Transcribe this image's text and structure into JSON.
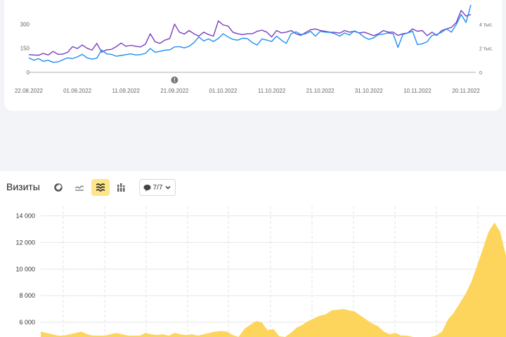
{
  "top_chart": {
    "type": "line",
    "x": [
      "22.08.2022",
      "23.08.2022",
      "24.08.2022",
      "25.08.2022",
      "26.08.2022",
      "27.08.2022",
      "28.08.2022",
      "29.08.2022",
      "30.08.2022",
      "31.08.2022",
      "01.09.2022",
      "02.09.2022",
      "03.09.2022",
      "04.09.2022",
      "05.09.2022",
      "06.09.2022",
      "07.09.2022",
      "08.09.2022",
      "09.09.2022",
      "10.09.2022",
      "11.09.2022",
      "12.09.2022",
      "13.09.2022",
      "14.09.2022",
      "15.09.2022",
      "16.09.2022",
      "17.09.2022",
      "18.09.2022",
      "19.09.2022",
      "20.09.2022",
      "21.09.2022",
      "22.09.2022",
      "23.09.2022",
      "24.09.2022",
      "25.09.2022",
      "26.09.2022",
      "27.09.2022",
      "28.09.2022",
      "29.09.2022",
      "30.09.2022",
      "01.10.2022",
      "02.10.2022",
      "03.10.2022",
      "04.10.2022",
      "05.10.2022",
      "06.10.2022",
      "07.10.2022",
      "08.10.2022",
      "09.10.2022",
      "10.10.2022",
      "11.10.2022",
      "12.10.2022",
      "13.10.2022",
      "14.10.2022",
      "15.10.2022",
      "16.10.2022",
      "17.10.2022",
      "18.10.2022",
      "19.10.2022",
      "20.10.2022",
      "21.10.2022",
      "22.10.2022",
      "23.10.2022",
      "24.10.2022",
      "25.10.2022",
      "26.10.2022",
      "27.10.2022",
      "28.10.2022",
      "29.10.2022",
      "30.10.2022",
      "31.10.2022",
      "01.11.2022",
      "02.11.2022",
      "03.11.2022",
      "04.11.2022",
      "05.11.2022",
      "06.11.2022",
      "07.11.2022",
      "08.11.2022",
      "09.11.2022",
      "10.11.2022",
      "11.11.2022",
      "12.11.2022",
      "13.11.2022",
      "14.11.2022",
      "15.11.2022",
      "16.11.2022",
      "17.11.2022",
      "18.11.2022",
      "19.11.2022",
      "20.11.2022",
      "21.11.2022"
    ],
    "x_tick_labels": [
      "22.08.2022",
      "01.09.2022",
      "11.09.2022",
      "21.09.2022",
      "01.10.2022",
      "11.10.2022",
      "21.10.2022",
      "31.10.2022",
      "10.11.2022",
      "20.11.2022"
    ],
    "y_left_ticks": [
      {
        "value": 0,
        "label": "0"
      },
      {
        "value": 150,
        "label": "150"
      },
      {
        "value": 300,
        "label": "300"
      }
    ],
    "y_right_ticks": [
      {
        "value": 0,
        "label": "0"
      },
      {
        "value": 2000,
        "label": "2 тыс."
      },
      {
        "value": 4000,
        "label": "4 тыс."
      }
    ],
    "ylim_left": [
      0,
      450
    ],
    "ylim_right": [
      0,
      6000
    ],
    "annotation_marker": {
      "x": "21.09.2022",
      "label": "!"
    },
    "series": [
      {
        "axis": "left",
        "color": "#7a3cbf",
        "values": [
          110,
          108,
          106,
          118,
          108,
          130,
          112,
          113,
          125,
          160,
          148,
          170,
          150,
          138,
          180,
          125,
          140,
          143,
          160,
          182,
          162,
          168,
          162,
          158,
          175,
          240,
          190,
          180,
          200,
          210,
          300,
          250,
          238,
          260,
          240,
          225,
          250,
          235,
          225,
          320,
          295,
          288,
          250,
          240,
          235,
          240,
          240,
          255,
          262,
          250,
          220,
          260,
          245,
          250,
          260,
          240,
          230,
          248,
          265,
          270,
          260,
          255,
          250,
          248,
          244,
          260,
          250,
          255,
          245,
          250,
          240,
          228,
          240,
          260,
          250,
          250,
          230,
          240,
          245,
          270,
          255,
          260,
          228,
          250,
          230,
          260,
          270,
          280,
          310,
          385,
          350,
          360
        ]
      },
      {
        "axis": "left",
        "color": "#1e8ff2",
        "values": [
          90,
          75,
          85,
          68,
          75,
          62,
          65,
          78,
          90,
          85,
          96,
          112,
          90,
          82,
          88,
          140,
          115,
          112,
          100,
          105,
          110,
          115,
          108,
          110,
          118,
          148,
          125,
          130,
          138,
          140,
          158,
          160,
          152,
          162,
          185,
          220,
          195,
          208,
          192,
          210,
          240,
          220,
          205,
          200,
          212,
          210,
          185,
          170,
          208,
          200,
          192,
          225,
          200,
          180,
          240,
          252,
          235,
          240,
          255,
          225,
          255,
          250,
          248,
          240,
          225,
          245,
          232,
          258,
          245,
          220,
          205,
          215,
          235,
          238,
          245,
          240,
          155,
          235,
          245,
          255,
          172,
          178,
          190,
          230,
          235,
          250,
          270,
          250,
          298,
          360,
          310,
          420
        ]
      }
    ]
  },
  "bottom_chart": {
    "title": "Визиты",
    "segments_label": "7/7",
    "type": "area",
    "y_ticks": [
      {
        "value": 6000,
        "label": "6 000"
      },
      {
        "value": 8000,
        "label": "8 000"
      },
      {
        "value": 10000,
        "label": "10 000"
      },
      {
        "value": 12000,
        "label": "12 000"
      },
      {
        "value": 14000,
        "label": "14 000"
      }
    ],
    "ylim": [
      5000,
      14500
    ],
    "series": [
      {
        "name": "",
        "color": "#fdd45c",
        "points": [
          [
            0,
            5300
          ],
          [
            1,
            5200
          ],
          [
            2,
            5100
          ],
          [
            3,
            5000
          ],
          [
            4,
            5000
          ],
          [
            5,
            5100
          ],
          [
            6,
            5200
          ],
          [
            7,
            5300
          ],
          [
            8,
            5100
          ],
          [
            9,
            5000
          ],
          [
            10,
            5000
          ],
          [
            11,
            5000
          ],
          [
            12,
            5100
          ],
          [
            13,
            5200
          ],
          [
            14,
            5100
          ],
          [
            15,
            5000
          ],
          [
            16,
            5000
          ],
          [
            17,
            5000
          ],
          [
            18,
            5200
          ],
          [
            19,
            5100
          ],
          [
            20,
            5050
          ],
          [
            21,
            5100
          ],
          [
            22,
            5000
          ],
          [
            23,
            5200
          ],
          [
            24,
            5100
          ],
          [
            25,
            5050
          ],
          [
            26,
            5100
          ],
          [
            27,
            5000
          ],
          [
            28,
            5100
          ],
          [
            29,
            5200
          ],
          [
            30,
            5300
          ],
          [
            31,
            5350
          ],
          [
            32,
            5300
          ],
          [
            33,
            5050
          ],
          [
            34,
            4900
          ],
          [
            35,
            5500
          ],
          [
            36,
            5800
          ],
          [
            37,
            6100
          ],
          [
            38,
            6000
          ],
          [
            39,
            5400
          ],
          [
            40,
            5500
          ],
          [
            41,
            4950
          ],
          [
            42,
            4900
          ],
          [
            43,
            5200
          ],
          [
            44,
            5600
          ],
          [
            45,
            5800
          ],
          [
            46,
            6100
          ],
          [
            47,
            6300
          ],
          [
            48,
            6500
          ],
          [
            49,
            6600
          ],
          [
            50,
            6900
          ],
          [
            51,
            6950
          ],
          [
            52,
            7000
          ],
          [
            53,
            6900
          ],
          [
            54,
            6800
          ],
          [
            55,
            6500
          ],
          [
            56,
            6200
          ],
          [
            57,
            5900
          ],
          [
            58,
            5700
          ],
          [
            59,
            5300
          ],
          [
            60,
            5100
          ],
          [
            61,
            5200
          ],
          [
            62,
            5000
          ],
          [
            63,
            5000
          ],
          [
            64,
            4900
          ],
          [
            65,
            4850
          ],
          [
            66,
            4800
          ],
          [
            67,
            4900
          ],
          [
            68,
            5000
          ],
          [
            69,
            5300
          ],
          [
            70,
            6200
          ],
          [
            71,
            6700
          ],
          [
            72,
            7400
          ],
          [
            73,
            8100
          ],
          [
            74,
            9000
          ],
          [
            75,
            10200
          ],
          [
            76,
            11500
          ],
          [
            77,
            12800
          ],
          [
            78,
            13500
          ],
          [
            79,
            12800
          ],
          [
            80,
            11000
          ]
        ]
      }
    ]
  }
}
